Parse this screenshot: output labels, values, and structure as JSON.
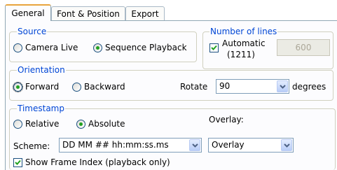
{
  "tabs": [
    {
      "label": "General"
    },
    {
      "label": "Font & Position"
    },
    {
      "label": "Export"
    }
  ],
  "source": {
    "legend": "Source",
    "options": [
      {
        "label": "Camera Live",
        "selected": false
      },
      {
        "label": "Sequence Playback",
        "selected": true
      }
    ]
  },
  "lines": {
    "legend": "Number of lines",
    "automatic_label": "Automatic",
    "automatic_value": "(1211)",
    "automatic_checked": true,
    "manual_value": "600"
  },
  "orientation": {
    "legend": "Orientation",
    "options": [
      {
        "label": "Forward",
        "selected": true
      },
      {
        "label": "Backward",
        "selected": false
      }
    ],
    "rotate_label": "Rotate",
    "rotate_value": "90",
    "degrees_label": "degrees"
  },
  "timestamp": {
    "legend": "Timestamp",
    "options": [
      {
        "label": "Relative",
        "selected": false
      },
      {
        "label": "Absolute",
        "selected": true
      }
    ],
    "overlay_label": "Overlay:",
    "scheme_label": "Scheme:",
    "scheme_value": "DD MM ## hh:mm:ss.ms",
    "overlay_value": "Overlay",
    "show_frame_index_label": "Show Frame Index (playback only)",
    "show_frame_index_checked": true
  },
  "colors": {
    "legend_text": "#0046d5",
    "radio_dot": "#21a121",
    "tab_active_accent": "#e8a43c"
  }
}
